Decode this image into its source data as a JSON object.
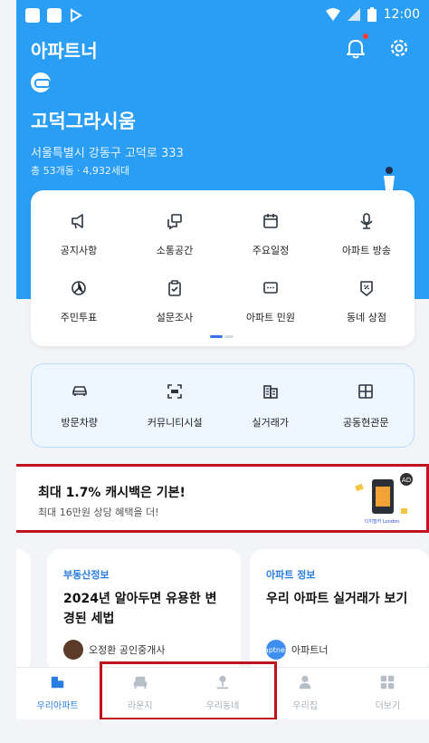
{
  "status_bar": {
    "time": "12:00"
  },
  "app": {
    "title": "아파트너"
  },
  "apartment": {
    "name": "고덕그라시움",
    "address": "서울특별시 강동구 고덕로 333",
    "buildings": "총 53개동",
    "households": "4,932세대"
  },
  "menu": {
    "items": [
      {
        "label": "공지사항",
        "icon": "megaphone-icon"
      },
      {
        "label": "소통공간",
        "icon": "chat-icon"
      },
      {
        "label": "주요일정",
        "icon": "calendar-icon"
      },
      {
        "label": "아파트 방송",
        "icon": "microphone-icon"
      },
      {
        "label": "주민투표",
        "icon": "pie-chart-icon"
      },
      {
        "label": "설문조사",
        "icon": "clipboard-check-icon"
      },
      {
        "label": "아파트 민원",
        "icon": "message-icon"
      },
      {
        "label": "동네 상점",
        "icon": "coupon-icon"
      }
    ]
  },
  "quick": {
    "items": [
      {
        "label": "방문차량",
        "icon": "car-icon"
      },
      {
        "label": "커뮤니티시설",
        "icon": "scan-icon"
      },
      {
        "label": "실거래가",
        "icon": "building-icon"
      },
      {
        "label": "공동현관문",
        "icon": "door-icon"
      }
    ]
  },
  "ad": {
    "title": "최대 1.7% 캐시백은 기본!",
    "subtitle": "최대 16만원 상당 혜택을 더!",
    "badge": "AD",
    "image_text": "디지털카 London"
  },
  "info_cards": [
    {
      "tag": "부동산정보",
      "headline": "2024년 알아두면 유용한 변경된 세법",
      "author": "오정환 공인중개사"
    },
    {
      "tag": "아파트 정보",
      "headline": "우리 아파트 실거래가 보기",
      "author": "아파트너",
      "avatar_text": "aptner"
    }
  ],
  "bottom_nav": [
    {
      "label": "우리아파트",
      "icon": "apartment-icon",
      "active": true
    },
    {
      "label": "라운지",
      "icon": "sofa-icon",
      "active": false
    },
    {
      "label": "우리동네",
      "icon": "person-location-icon",
      "active": false
    },
    {
      "label": "우리집",
      "icon": "person-icon",
      "active": false
    },
    {
      "label": "더보기",
      "icon": "grid-icon",
      "active": false
    }
  ],
  "colors": {
    "primary": "#2a9df4",
    "accent": "#2a7de1",
    "highlight": "#c1121f"
  }
}
